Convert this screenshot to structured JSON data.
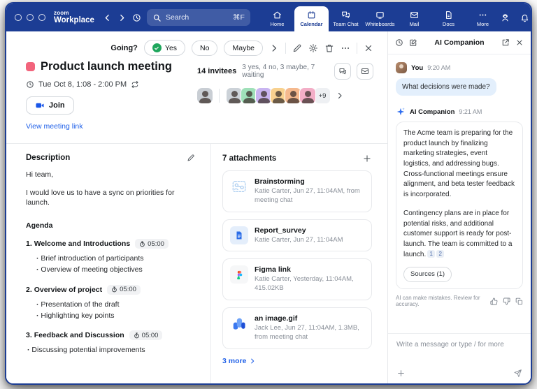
{
  "titlebar": {
    "brand_top": "zoom",
    "brand_bottom": "Workplace",
    "search_placeholder": "Search",
    "search_shortcut": "⌘F",
    "tabs": [
      {
        "label": "Home",
        "active": false
      },
      {
        "label": "Calendar",
        "active": true
      },
      {
        "label": "Team Chat",
        "active": false
      },
      {
        "label": "Whiteboards",
        "active": false
      },
      {
        "label": "Mail",
        "active": false
      },
      {
        "label": "Docs",
        "active": false
      },
      {
        "label": "More",
        "active": false
      }
    ]
  },
  "meeting": {
    "going_label": "Going?",
    "rsvp": [
      "Yes",
      "No",
      "Maybe"
    ],
    "title": "Product launch meeting",
    "datetime": "Tue Oct 8, 1:08 - 2:00 PM",
    "join_label": "Join",
    "meeting_link_label": "View meeting link",
    "invitees": {
      "count_label": "14 invitees",
      "summary": "3 yes, 4 no, 3 maybe, 7 waiting",
      "overflow": "+9",
      "organizer_color": "#c9ced4",
      "avatar_colors": [
        "#ccd2d8",
        "#9fe0b9",
        "#c9b5f1",
        "#f8d18f",
        "#f5b98e",
        "#f3aec7"
      ]
    }
  },
  "description": {
    "heading": "Description",
    "greeting": "Hi team,",
    "intro": "I would love us to have a sync on priorities for launch.",
    "agenda_heading": "Agenda",
    "agenda": [
      {
        "num": "1.",
        "title": "Welcome and Introductions",
        "duration": "05:00",
        "bullets": [
          "Brief introduction of participants",
          "Overview of meeting objectives"
        ]
      },
      {
        "num": "2.",
        "title": "Overview of project",
        "duration": "05:00",
        "bullets": [
          "Presentation of the draft",
          "Highlighting key points"
        ]
      },
      {
        "num": "3.",
        "title": "Feedback and Discussion",
        "duration": "05:00",
        "bullets": [
          "Discussing potential improvements"
        ]
      }
    ]
  },
  "attachments": {
    "heading": "7 attachments",
    "items": [
      {
        "name": "Brainstorming",
        "meta": "Katie Carter, Jun 27, 11:04AM, from meeting chat",
        "icon": "whiteboard-icon"
      },
      {
        "name": "Report_survey",
        "meta": "Katie Carter, Jun 27, 11:04AM",
        "icon": "document-icon"
      },
      {
        "name": "Figma link",
        "meta": "Katie Carter, Yesterday, 11:04AM, 415.02KB",
        "icon": "figma-icon"
      },
      {
        "name": "an image.gif",
        "meta": "Jack Lee, Jun 27, 11:04AM, 1.3MB, from meeting chat",
        "icon": "image-icon"
      }
    ],
    "more_label": "3 more"
  },
  "ai_panel": {
    "title": "AI Companion",
    "user_label": "You",
    "user_time": "9:20 AM",
    "user_message": "What decisions were made?",
    "ai_label": "AI Companion",
    "ai_time": "9:21 AM",
    "ai_paragraph1": "The Acme team is preparing for the product launch by finalizing marketing strategies, event logistics, and addressing bugs. Cross-functional meetings ensure alignment, and beta tester feedback is incorporated.",
    "ai_paragraph2": "Contingency plans are in place for potential risks, and additional customer support is ready for post-launch. The team is committed to a launch.",
    "citations": [
      "1",
      "2"
    ],
    "sources_label": "Sources (1)",
    "disclaimer": "AI can make mistakes. Review for accuracy.",
    "input_placeholder": "Write a message or type / for more"
  },
  "colors": {
    "titlebar_blue": "#1c3d94",
    "link_blue": "#2161e8",
    "meeting_color": "#f2647c",
    "rsvp_green": "#1ea65c",
    "user_bubble": "#e3effc",
    "status_green": "#22c55e"
  }
}
